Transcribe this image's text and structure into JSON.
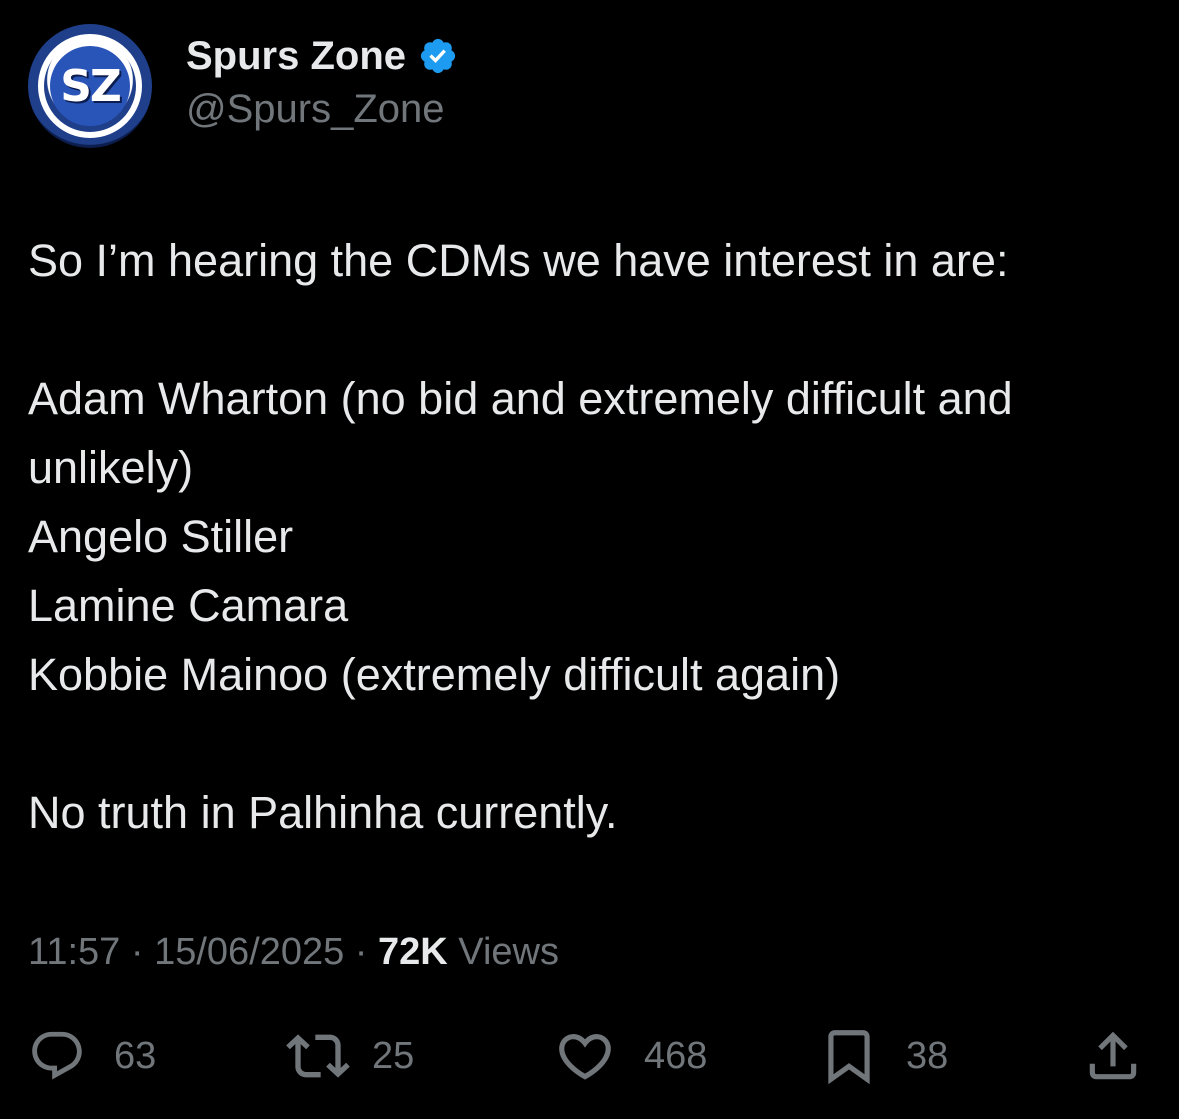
{
  "account": {
    "display_name": "Spurs Zone",
    "handle": "@Spurs_Zone",
    "avatar_text": "SZ",
    "verified": true
  },
  "tweet": {
    "lines": [
      "So I’m hearing the CDMs we have interest in are:",
      "",
      "Adam Wharton (no bid and extremely difficult and unlikely)",
      "Angelo Stiller",
      "Lamine Camara",
      "Kobbie Mainoo (extremely difficult again)",
      "",
      "No truth in Palhinha currently."
    ]
  },
  "meta": {
    "time": "11:57",
    "separator": " · ",
    "date": "15/06/2025",
    "views_count": "72K",
    "views_label": " Views"
  },
  "actions": {
    "replies": "63",
    "reposts": "25",
    "likes": "468",
    "bookmarks": "38"
  },
  "colors": {
    "background": "#000000",
    "text_primary": "#e7e9ea",
    "text_secondary": "#71767b",
    "verified": "#1d9bf0"
  },
  "icons": {
    "verified": "verified-badge-icon",
    "reply": "reply-icon",
    "repost": "repost-icon",
    "like": "heart-icon",
    "bookmark": "bookmark-icon",
    "share": "share-icon"
  }
}
